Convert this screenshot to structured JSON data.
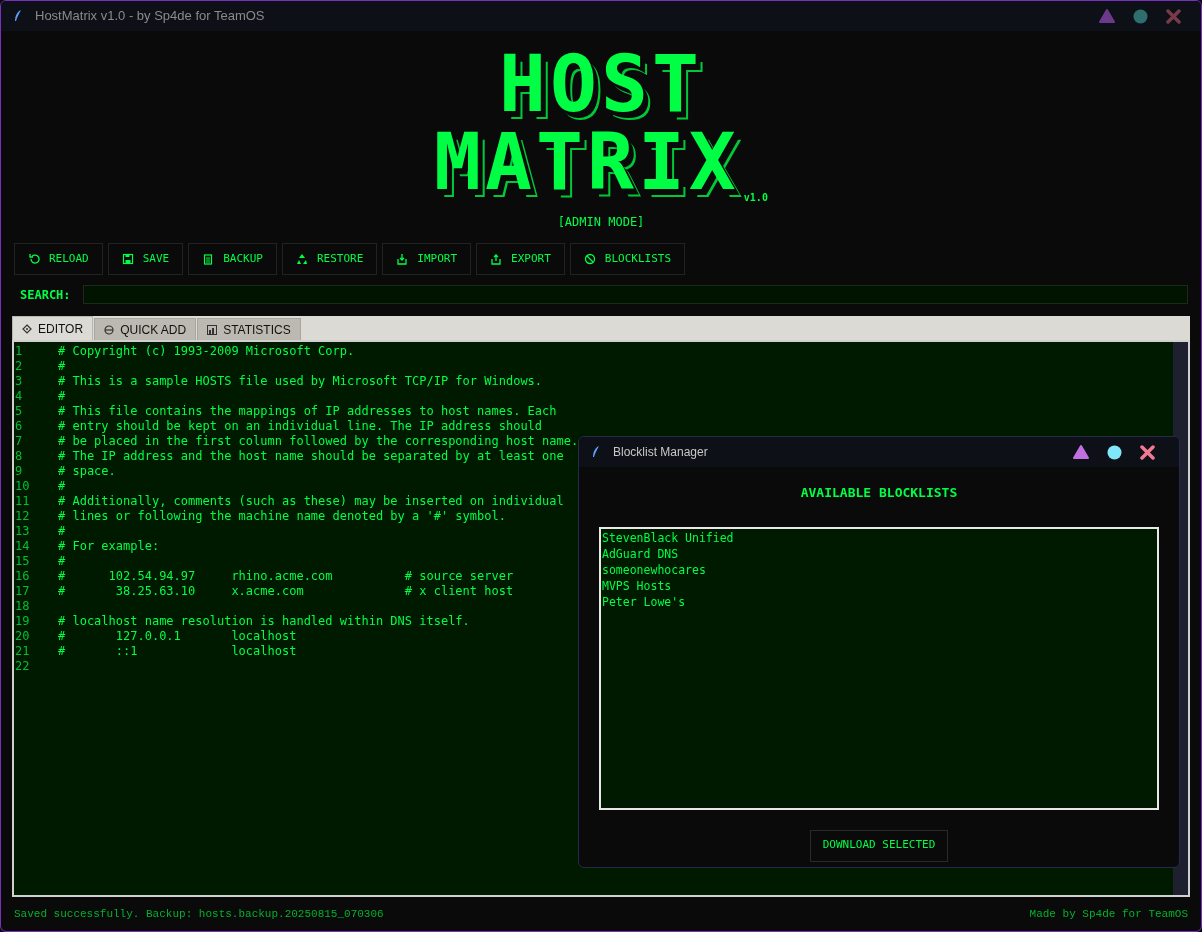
{
  "window": {
    "title": "HostMatrix v1.0 - by Sp4de for TeamOS"
  },
  "logo": {
    "line_1": "HOST",
    "line_2": "MATRIX",
    "version": "v1.0"
  },
  "mode": "[ADMIN MODE]",
  "toolbar": [
    {
      "label": "RELOAD",
      "kind": "reload"
    },
    {
      "label": "SAVE",
      "kind": "save"
    },
    {
      "label": "BACKUP",
      "kind": "backup"
    },
    {
      "label": "RESTORE",
      "kind": "restore"
    },
    {
      "label": "IMPORT",
      "kind": "import"
    },
    {
      "label": "EXPORT",
      "kind": "export"
    },
    {
      "label": "BLOCKLISTS",
      "kind": "blocklists"
    }
  ],
  "search": {
    "label": "SEARCH:"
  },
  "tabs": [
    {
      "label": "EDITOR",
      "kind": "editor",
      "selected": true
    },
    {
      "label": "QUICK ADD",
      "kind": "add",
      "selected": false
    },
    {
      "label": "STATISTICS",
      "kind": "stats",
      "selected": false
    }
  ],
  "editor": {
    "lines": [
      {
        "number": "1",
        "text": "# Copyright (c) 1993-2009 Microsoft Corp."
      },
      {
        "number": "2",
        "text": "#"
      },
      {
        "number": "3",
        "text": "# This is a sample HOSTS file used by Microsoft TCP/IP for Windows."
      },
      {
        "number": "4",
        "text": "#"
      },
      {
        "number": "5",
        "text": "# This file contains the mappings of IP addresses to host names. Each"
      },
      {
        "number": "6",
        "text": "# entry should be kept on an individual line. The IP address should"
      },
      {
        "number": "7",
        "text": "# be placed in the first column followed by the corresponding host name."
      },
      {
        "number": "8",
        "text": "# The IP address and the host name should be separated by at least one"
      },
      {
        "number": "9",
        "text": "# space."
      },
      {
        "number": "10",
        "text": "#"
      },
      {
        "number": "11",
        "text": "# Additionally, comments (such as these) may be inserted on individual"
      },
      {
        "number": "12",
        "text": "# lines or following the machine name denoted by a '#' symbol."
      },
      {
        "number": "13",
        "text": "#"
      },
      {
        "number": "14",
        "text": "# For example:"
      },
      {
        "number": "15",
        "text": "#"
      },
      {
        "number": "16",
        "text": "#      102.54.94.97     rhino.acme.com          # source server"
      },
      {
        "number": "17",
        "text": "#       38.25.63.10     x.acme.com              # x client host"
      },
      {
        "number": "18"
      },
      {
        "number": "19",
        "text": "# localhost name resolution is handled within DNS itself."
      },
      {
        "number": "20",
        "text": "#       127.0.0.1       localhost"
      },
      {
        "number": "21",
        "text": "#       ::1             localhost"
      },
      {
        "number": "22"
      }
    ]
  },
  "dialog": {
    "title": "Blocklist Manager",
    "heading": "AVAILABLE BLOCKLISTS",
    "items": [
      "StevenBlack Unified",
      "AdGuard DNS",
      "someonewhocares",
      "MVPS Hosts",
      "Peter Lowe's"
    ],
    "button": "DOWNLOAD SELECTED"
  },
  "status_bar": {
    "message": "Saved successfully. Backup: hosts.backup.20250815_070306",
    "credit": "Made by Sp4de for TeamOS"
  }
}
